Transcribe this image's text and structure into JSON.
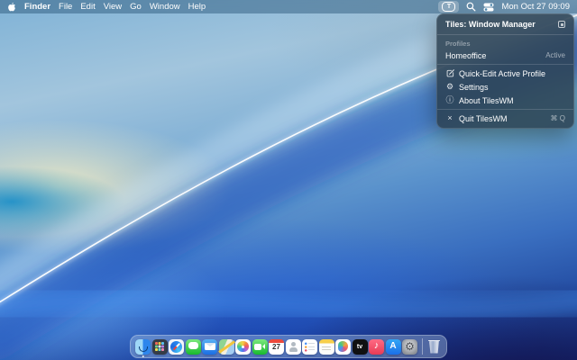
{
  "menu_bar": {
    "app_name": "Finder",
    "menus": [
      "File",
      "Edit",
      "View",
      "Go",
      "Window",
      "Help"
    ],
    "status": {
      "tiles_letter": "T",
      "clock": "Mon Oct 27 09:09"
    }
  },
  "tiles_menu": {
    "title": "Tiles: Window Manager",
    "section_label": "Profiles",
    "profile_name": "Homeoffice",
    "profile_status": "Active",
    "items": [
      {
        "icon": "square-pencil",
        "label": "Quick-Edit Active Profile"
      },
      {
        "icon": "gear",
        "label": "Settings"
      },
      {
        "icon": "info",
        "label": "About TilesWM"
      }
    ],
    "quit_label": "Quit TilesWM",
    "quit_shortcut": "⌘ Q"
  },
  "glyphs": {
    "gear": "⚙",
    "info": "ⓘ",
    "xmark": "×"
  },
  "dock": {
    "items": [
      {
        "name": "finder",
        "running": true
      },
      {
        "name": "launchpad"
      },
      {
        "name": "safari"
      },
      {
        "name": "messages"
      },
      {
        "name": "mail"
      },
      {
        "name": "maps"
      },
      {
        "name": "photos"
      },
      {
        "name": "facetime"
      },
      {
        "name": "calendar",
        "label": "27"
      },
      {
        "name": "contacts"
      },
      {
        "name": "reminders"
      },
      {
        "name": "notes"
      },
      {
        "name": "freeform"
      },
      {
        "name": "appletv",
        "label": "tv"
      },
      {
        "name": "music"
      },
      {
        "name": "appstore"
      },
      {
        "name": "settings"
      },
      {
        "name": "trash",
        "separator_before": true
      }
    ]
  },
  "colors": {
    "menu_panel_bg": "rgba(40,60,76,0.82)",
    "menubar_bg": "rgba(48,92,126,0.5)",
    "wallpaper_deep_blue": "#20489f",
    "wallpaper_sky": "#a2c5dd"
  }
}
